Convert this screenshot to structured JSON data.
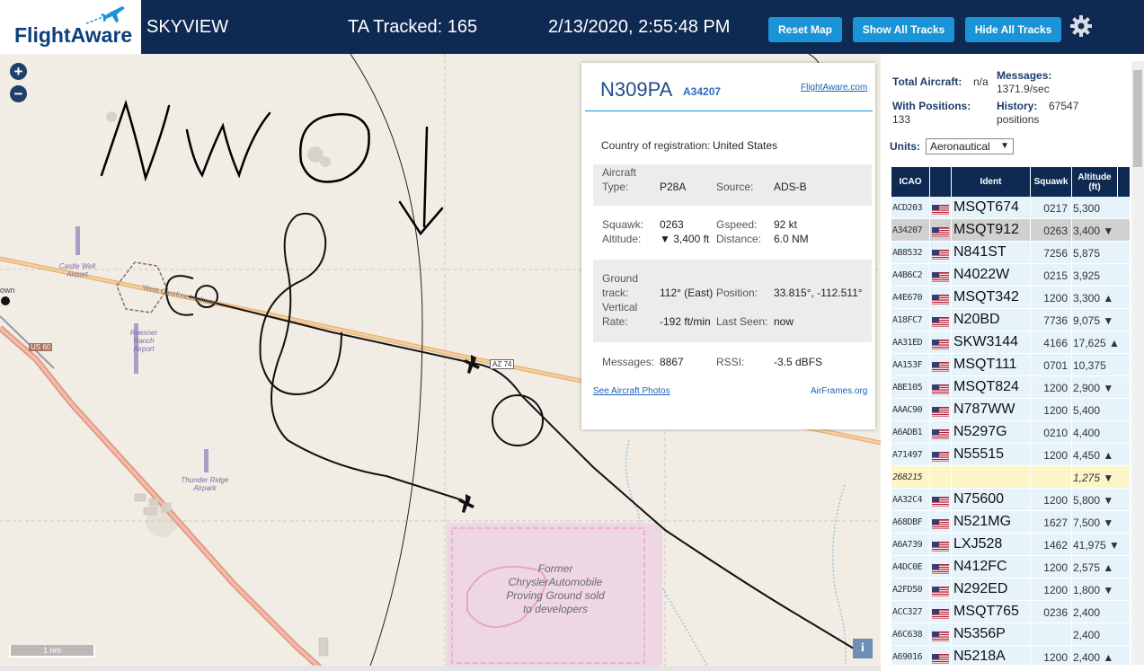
{
  "header": {
    "logo_text": "FlightAware",
    "app_title": "SKYVIEW",
    "ta_tracked": "TA Tracked: 165",
    "datetime": "2/13/2020, 2:55:48 PM",
    "buttons": {
      "reset_map": "Reset Map",
      "show_all_tracks": "Show All Tracks",
      "hide_all_tracks": "Hide All Tracks"
    },
    "settings_icon": "gear-icon"
  },
  "map": {
    "zoom_in": "+",
    "zoom_out": "−",
    "labels": {
      "castle_well": "Castle Well Airport",
      "roesner": "Roesner Ranch Airport",
      "thunder_ridge": "Thunder Ridge Airpark",
      "us60": "US 60",
      "az74": "AZ 74",
      "west_carefree": "West Carefree Highway",
      "town": "own",
      "chrysler": "Former ChryslerAutomobile Proving Ground sold to developers"
    },
    "scale": "1 nm",
    "info": "i"
  },
  "popup": {
    "ident": "N309PA",
    "hex": "A34207",
    "flightaware_link": "FlightAware.com",
    "country_label": "Country of registration:",
    "country_value": "United States",
    "aircraft_type_label_1": "Aircraft",
    "aircraft_type_label_2": "Type:",
    "aircraft_type_value": "P28A",
    "source_label": "Source:",
    "source_value": "ADS-B",
    "squawk_label": "Squawk:",
    "squawk_value": "0263",
    "gspeed_label": "Gspeed:",
    "gspeed_value": "92 kt",
    "altitude_label": "Altitude:",
    "altitude_value": "▼ 3,400 ft",
    "distance_label": "Distance:",
    "distance_value": "6.0 NM",
    "ground_label_1": "Ground",
    "ground_label_2": "track:",
    "ground_value": "112° (East)",
    "position_label": "Position:",
    "position_value": "33.815°, -112.511°",
    "vrate_label_1": "Vertical",
    "vrate_label_2": "Rate:",
    "vrate_value": "-192 ft/min",
    "lastseen_label": "Last Seen:",
    "lastseen_value": "now",
    "messages_label": "Messages:",
    "messages_value": "8867",
    "rssi_label": "RSSI:",
    "rssi_value": "-3.5 dBFS",
    "photos_link": "See Aircraft Photos",
    "airframes_link": "AirFrames.org"
  },
  "stats": {
    "total_aircraft_label": "Total Aircraft:",
    "total_aircraft_value": "n/a",
    "with_positions_label": "With Positions:",
    "with_positions_value": "133",
    "messages_label": "Messages:",
    "messages_value": "1371.9/sec",
    "history_label": "History:",
    "history_value_1": "67547",
    "history_value_2": "positions",
    "units_label": "Units:",
    "units_value": "Aeronautical"
  },
  "table": {
    "headers": {
      "icao": "ICAO",
      "ident": "Ident",
      "squawk": "Squawk",
      "altitude": "Altitude (ft)"
    },
    "rows": [
      {
        "icao": "ACD203",
        "flag": true,
        "ident": "MSQT674",
        "squawk": "0217",
        "alt": "5,300"
      },
      {
        "icao": "A34207",
        "flag": true,
        "ident": "MSQT912",
        "squawk": "0263",
        "alt": "3,400 ▼",
        "selected": true
      },
      {
        "icao": "AB8532",
        "flag": true,
        "ident": "N841ST",
        "squawk": "7256",
        "alt": "5,875"
      },
      {
        "icao": "A4B6C2",
        "flag": true,
        "ident": "N4022W",
        "squawk": "0215",
        "alt": "3,925"
      },
      {
        "icao": "A4E670",
        "flag": true,
        "ident": "MSQT342",
        "squawk": "1200",
        "alt": "3,300 ▲"
      },
      {
        "icao": "A18FC7",
        "flag": true,
        "ident": "N20BD",
        "squawk": "7736",
        "alt": "9,075 ▼"
      },
      {
        "icao": "AA31ED",
        "flag": true,
        "ident": "SKW3144",
        "squawk": "4166",
        "alt": "17,625 ▲"
      },
      {
        "icao": "AA153F",
        "flag": true,
        "ident": "MSQT111",
        "squawk": "0701",
        "alt": "10,375"
      },
      {
        "icao": "ABE105",
        "flag": true,
        "ident": "MSQT824",
        "squawk": "1200",
        "alt": "2,900 ▼"
      },
      {
        "icao": "AAAC90",
        "flag": true,
        "ident": "N787WW",
        "squawk": "1200",
        "alt": "5,400"
      },
      {
        "icao": "A6ADB1",
        "flag": true,
        "ident": "N5297G",
        "squawk": "0210",
        "alt": "4,400"
      },
      {
        "icao": "A71497",
        "flag": true,
        "ident": "N55515",
        "squawk": "1200",
        "alt": "4,450 ▲"
      },
      {
        "icao": "268215",
        "flag": false,
        "ident": "",
        "squawk": "",
        "alt": "1,275 ▼",
        "noflag": true
      },
      {
        "icao": "AA32C4",
        "flag": true,
        "ident": "N75600",
        "squawk": "1200",
        "alt": "5,800 ▼"
      },
      {
        "icao": "A68DBF",
        "flag": true,
        "ident": "N521MG",
        "squawk": "1627",
        "alt": "7,500 ▼"
      },
      {
        "icao": "A6A739",
        "flag": true,
        "ident": "LXJ528",
        "squawk": "1462",
        "alt": "41,975 ▼"
      },
      {
        "icao": "A4DC0E",
        "flag": true,
        "ident": "N412FC",
        "squawk": "1200",
        "alt": "2,575 ▲"
      },
      {
        "icao": "A2FD50",
        "flag": true,
        "ident": "N292ED",
        "squawk": "1200",
        "alt": "1,800 ▼"
      },
      {
        "icao": "ACC327",
        "flag": true,
        "ident": "MSQT765",
        "squawk": "0236",
        "alt": "2,400"
      },
      {
        "icao": "A6C638",
        "flag": true,
        "ident": "N5356P",
        "squawk": "",
        "alt": "2,400"
      },
      {
        "icao": "A69016",
        "flag": true,
        "ident": "N5218A",
        "squawk": "1200",
        "alt": "2,400 ▲"
      }
    ]
  }
}
